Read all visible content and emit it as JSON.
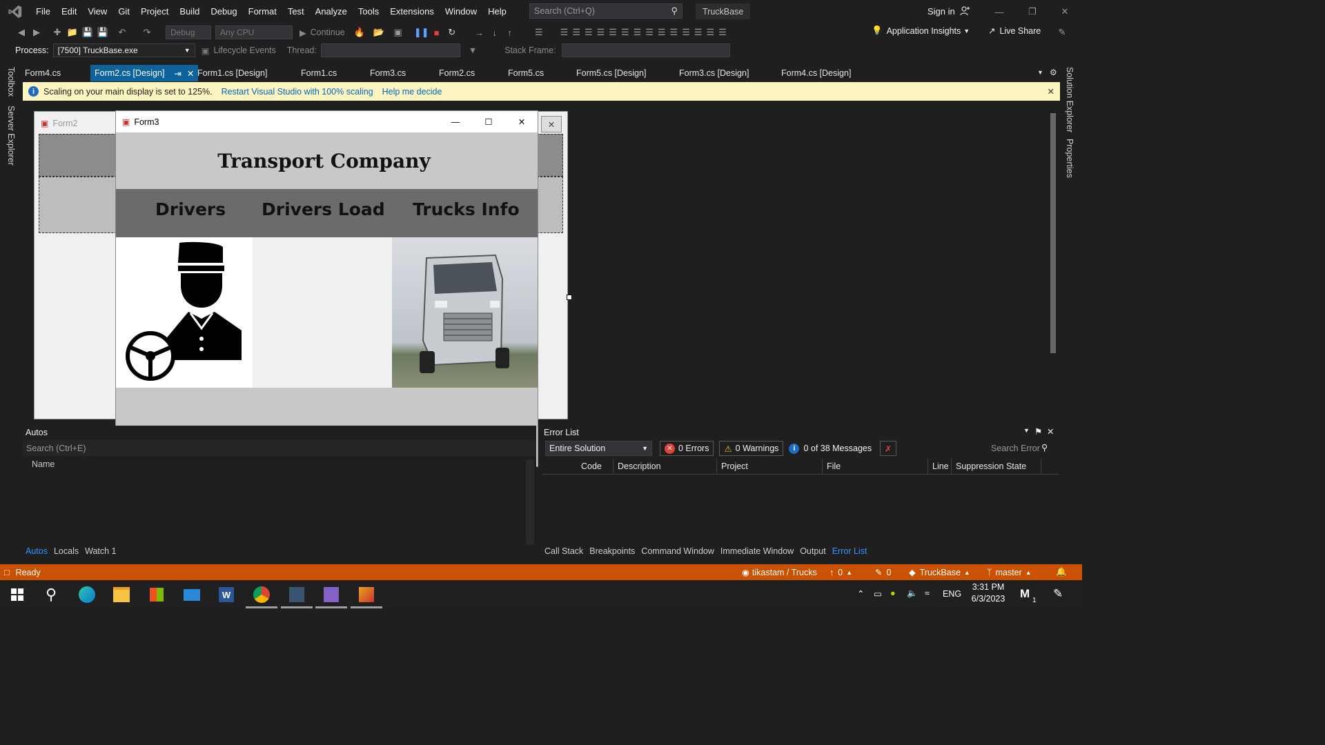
{
  "menubar": {
    "items": [
      "File",
      "Edit",
      "View",
      "Git",
      "Project",
      "Build",
      "Debug",
      "Format",
      "Test",
      "Analyze",
      "Tools",
      "Extensions",
      "Window",
      "Help"
    ],
    "search_placeholder": "Search (Ctrl+Q)",
    "solution_name": "TruckBase",
    "sign_in": "Sign in"
  },
  "toolbar": {
    "config": "Debug",
    "platform": "Any CPU",
    "continue_label": "Continue",
    "app_insights": "Application Insights",
    "live_share": "Live Share"
  },
  "process_bar": {
    "process_label": "Process:",
    "process_value": "[7500] TruckBase.exe",
    "lifecycle": "Lifecycle Events",
    "thread_label": "Thread:",
    "stack_frame_label": "Stack Frame:"
  },
  "tabs": [
    "Form4.cs",
    "Form2.cs [Design]",
    "Form1.cs [Design]",
    "Form1.cs",
    "Form3.cs",
    "Form2.cs",
    "Form5.cs",
    "Form5.cs [Design]",
    "Form3.cs [Design]",
    "Form4.cs [Design]"
  ],
  "active_tab": "Form2.cs [Design]",
  "infobar": {
    "message": "Scaling on your main display is set to 125%.",
    "restart_link": "Restart Visual Studio with 100% scaling",
    "help_link": "Help me decide"
  },
  "side": {
    "left": [
      "Toolbox",
      "Server Explorer"
    ],
    "right": [
      "Solution Explorer",
      "Properties"
    ]
  },
  "form2": {
    "title": "Form2"
  },
  "form3": {
    "title": "Form3",
    "heading": "Transport Company",
    "nav": [
      "Drivers",
      "Drivers Load",
      "Trucks Info"
    ]
  },
  "autos": {
    "title": "Autos",
    "search_placeholder": "Search (Ctrl+E)",
    "columns": [
      "Name"
    ],
    "tabs": [
      "Autos",
      "Locals",
      "Watch 1"
    ]
  },
  "error_list": {
    "title": "Error List",
    "scope": "Entire Solution",
    "errors": "0 Errors",
    "warnings": "0 Warnings",
    "messages": "0 of 38 Messages",
    "search_placeholder": "Search Error",
    "columns": [
      "Code",
      "Description",
      "Project",
      "File",
      "Line",
      "Suppression State"
    ],
    "tabs": [
      "Call Stack",
      "Breakpoints",
      "Command Window",
      "Immediate Window",
      "Output",
      "Error List"
    ]
  },
  "statusbar": {
    "ready": "Ready",
    "repo": "tikastam / Trucks",
    "push_count": "0",
    "changes_count": "0",
    "solution": "TruckBase",
    "branch": "master"
  },
  "taskbar": {
    "language": "ENG",
    "time": "3:31 PM",
    "date": "6/3/2023",
    "notification_count": "1"
  },
  "colors": {
    "accent": "#0e639c",
    "statusbar": "#ca5100",
    "infobar": "#fcf5bf",
    "link": "#3794ff"
  }
}
